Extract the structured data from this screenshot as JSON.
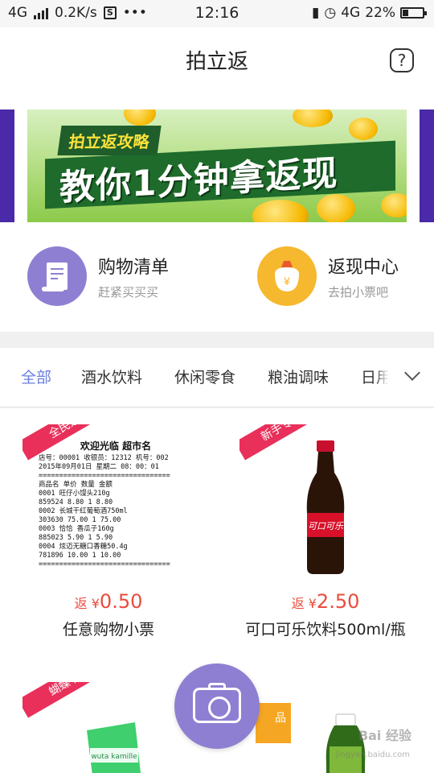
{
  "status_bar": {
    "network": "4G",
    "speed": "0.2K/s",
    "sim_icon": "S",
    "more": "•••",
    "time": "12:16",
    "net_right": "4G",
    "battery": "22%"
  },
  "header": {
    "title": "拍立返",
    "help_label": "?"
  },
  "banner": {
    "tag": "拍立返攻略",
    "headline": "教你1分钟拿返现",
    "colors": {
      "bg": "#a8d878",
      "ribbon": "#1e6b2b"
    }
  },
  "quick_entries": [
    {
      "title": "购物清单",
      "subtitle": "赶紧买买买",
      "icon": "shopping-list-icon",
      "color": "#8f7fd2"
    },
    {
      "title": "返现中心",
      "subtitle": "去拍小票吧",
      "icon": "cashback-bag-icon",
      "color": "#f5b82e"
    }
  ],
  "tabs": [
    "全部",
    "酒水饮料",
    "休闲零食",
    "粮油调味",
    "日用"
  ],
  "products": [
    {
      "badge": "全民返",
      "price_prefix": "返",
      "currency": "¥",
      "price": "0.50",
      "name": "任意购物小票",
      "receipt": {
        "header": "欢迎光临 超市名",
        "line1": "店号：00001 收银员：12312 机号：002",
        "line2": "2015年09月01日 星期二 08：00：01",
        "sep": "================================",
        "cols": "商品名    单价   数量   金额",
        "rows": [
          "0001 旺仔小馒头210g",
          "859524     8.80    1    8.80",
          "0002 长城干红葡萄酒750ml",
          "303630    75.00    1   75.00",
          "0003 恰恰 香瓜子160g",
          "885023     5.90    1    5.90",
          "0004 炫迈无糖口香糖50.4g",
          "781896    10.00    1   10.00"
        ]
      }
    },
    {
      "badge": "新手专享",
      "price_prefix": "返",
      "currency": "¥",
      "price": "2.50",
      "name": "可口可乐饮料500ml/瓶",
      "bottle_label": "可口可乐"
    },
    {
      "badge": "蝴蝶节",
      "tube_text": "wuta kamille"
    },
    {
      "badge_partial": "品"
    }
  ],
  "fab": {
    "icon": "camera-icon"
  },
  "watermark": {
    "line1": "Bai 经验",
    "line2": "jingyan.baidu.com"
  }
}
